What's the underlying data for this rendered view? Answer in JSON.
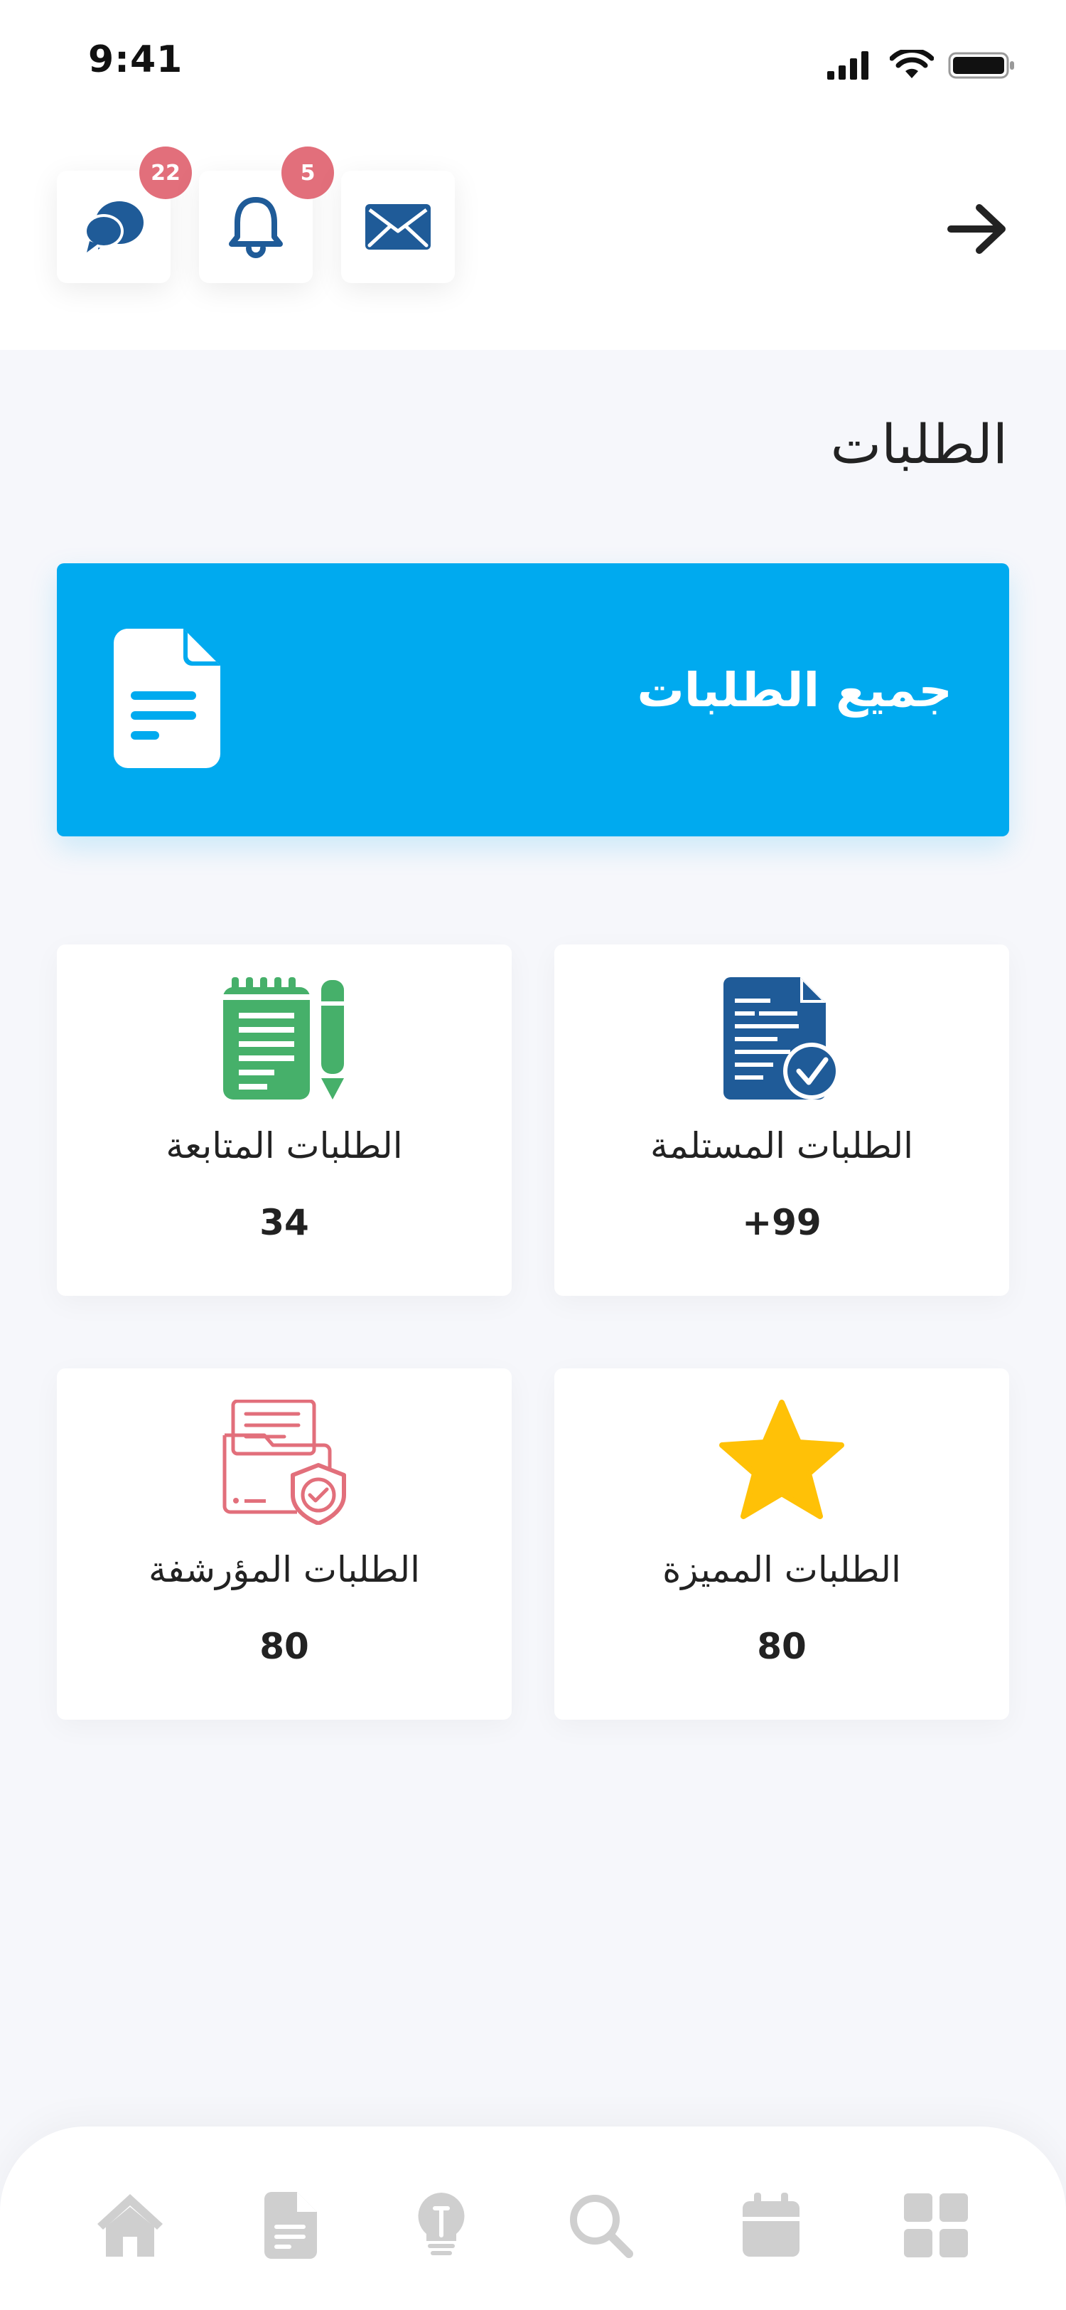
{
  "status_bar": {
    "time": "9:41"
  },
  "header": {
    "back_icon": "arrow-right-icon",
    "actions": [
      {
        "name": "chat",
        "icon": "chat-bubbles-icon",
        "badge": "22"
      },
      {
        "name": "notifications",
        "icon": "bell-icon",
        "badge": "5"
      },
      {
        "name": "mail",
        "icon": "envelope-icon",
        "badge": ""
      }
    ]
  },
  "page": {
    "title": "الطلبات"
  },
  "hero": {
    "label": "جميع الطلبات",
    "icon": "document-icon"
  },
  "cards": [
    {
      "label": "الطلبات المستلمة",
      "count": "+99",
      "icon": "received-document-check-icon",
      "color": "#1f5b98"
    },
    {
      "label": "الطلبات المتابعة",
      "count": "34",
      "icon": "notepad-pencil-icon",
      "color": "#46b06a"
    },
    {
      "label": "الطلبات المميزة",
      "count": "80",
      "icon": "star-icon",
      "color": "#ffc107"
    },
    {
      "label": "الطلبات المؤرشفة",
      "count": "80",
      "icon": "archive-folder-shield-icon",
      "color": "#e26f7b"
    }
  ],
  "bottom_nav": {
    "items": [
      {
        "name": "home",
        "icon": "home-icon"
      },
      {
        "name": "documents",
        "icon": "document-icon"
      },
      {
        "name": "ideas",
        "icon": "lightbulb-icon"
      },
      {
        "name": "search",
        "icon": "search-icon"
      },
      {
        "name": "calendar",
        "icon": "calendar-icon"
      },
      {
        "name": "apps",
        "icon": "grid-icon"
      }
    ]
  },
  "colors": {
    "accent": "#00aaef",
    "badge": "#e26f7b",
    "nav_icon": "#cfcfcf",
    "background": "#f6f7fb"
  }
}
